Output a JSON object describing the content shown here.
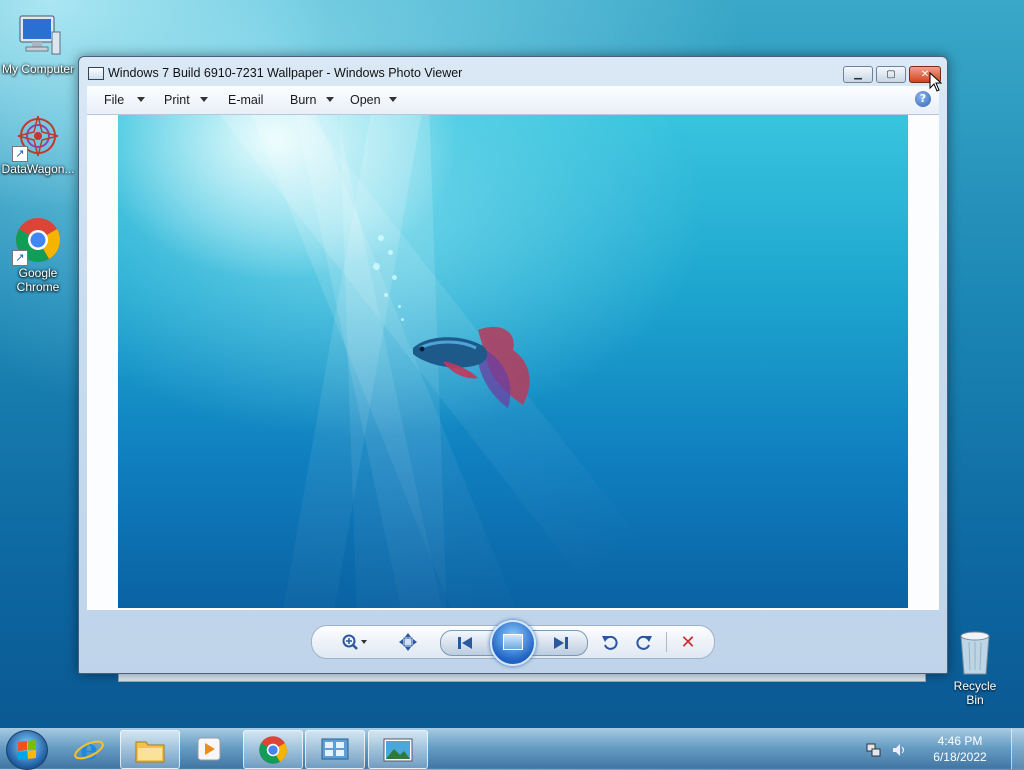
{
  "desktop": {
    "icons": [
      {
        "label": "My Computer"
      },
      {
        "label": "DataWagon..."
      },
      {
        "label": "Google Chrome"
      }
    ],
    "recycle_bin": {
      "label": "Recycle Bin"
    }
  },
  "window": {
    "title": "Windows 7 Build 6910-7231 Wallpaper - Windows Photo Viewer",
    "menu": [
      {
        "label": "File",
        "has_dropdown": true
      },
      {
        "label": "Print",
        "has_dropdown": true
      },
      {
        "label": "E-mail",
        "has_dropdown": false
      },
      {
        "label": "Burn",
        "has_dropdown": true
      },
      {
        "label": "Open",
        "has_dropdown": true
      }
    ],
    "help_label": "?",
    "controls": {
      "zoom_icon": "zoom-icon",
      "fit_icon": "actual-size-icon",
      "previous_icon": "previous-icon",
      "slideshow_icon": "slideshow-icon",
      "next_icon": "next-icon",
      "rotate_ccw_icon": "rotate-counterclockwise-icon",
      "rotate_cw_icon": "rotate-clockwise-icon",
      "delete_icon": "delete-icon"
    }
  },
  "taskbar": {
    "pinned": [
      "start-button",
      "internet-explorer-icon",
      "file-explorer-icon",
      "media-player-icon",
      "chrome-icon",
      "control-panel-icon",
      "photo-viewer-icon"
    ],
    "clock": {
      "time": "4:46 PM",
      "date": "6/18/2022"
    }
  },
  "colors": {
    "accent": "#1f62c4",
    "close": "#d34421"
  }
}
